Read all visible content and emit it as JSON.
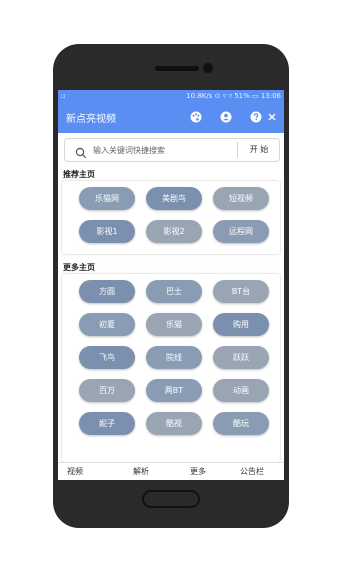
{
  "status": {
    "left": "▫",
    "right": "10.8K/s ⊙ ▿ ▿ 51% ▭ 13:06"
  },
  "app": {
    "title": "新点亮视频"
  },
  "search": {
    "placeholder": "输入关键词快捷搜索",
    "button": "开 始"
  },
  "recommended": {
    "title": "推荐主页",
    "items": [
      {
        "label": "乐猫网",
        "color": "#8a9cb3"
      },
      {
        "label": "美剧鸟",
        "color": "#7b8fae"
      },
      {
        "label": "短视频",
        "color": "#9aa5b4"
      },
      {
        "label": "影视1",
        "color": "#7b8fae"
      },
      {
        "label": "影视2",
        "color": "#9aa5b4"
      },
      {
        "label": "远程网",
        "color": "#8a9cb3"
      }
    ]
  },
  "more": {
    "title": "更多主页",
    "items": [
      {
        "label": "方圆",
        "color": "#7b8fae"
      },
      {
        "label": "巴士",
        "color": "#8a9cb3"
      },
      {
        "label": "BT台",
        "color": "#9aa5b4"
      },
      {
        "label": "初夏",
        "color": "#8a9cb3"
      },
      {
        "label": "乐猫",
        "color": "#9aa5b4"
      },
      {
        "label": "购用",
        "color": "#7b8fae"
      },
      {
        "label": "飞鸟",
        "color": "#7b8fae"
      },
      {
        "label": "院线",
        "color": "#8a9cb3"
      },
      {
        "label": "跃跃",
        "color": "#9aa5b4"
      },
      {
        "label": "百万",
        "color": "#9aa5b4"
      },
      {
        "label": "两BT",
        "color": "#8a9cb3"
      },
      {
        "label": "动画",
        "color": "#9aa5b4"
      },
      {
        "label": "妮子",
        "color": "#7b8fae"
      },
      {
        "label": "酷视",
        "color": "#9aa5b4"
      },
      {
        "label": "酷玩",
        "color": "#8a9cb3"
      }
    ]
  },
  "nav": {
    "items": [
      {
        "label": "视频"
      },
      {
        "label": "解析"
      },
      {
        "label": "更多"
      },
      {
        "label": "公告栏"
      }
    ]
  }
}
